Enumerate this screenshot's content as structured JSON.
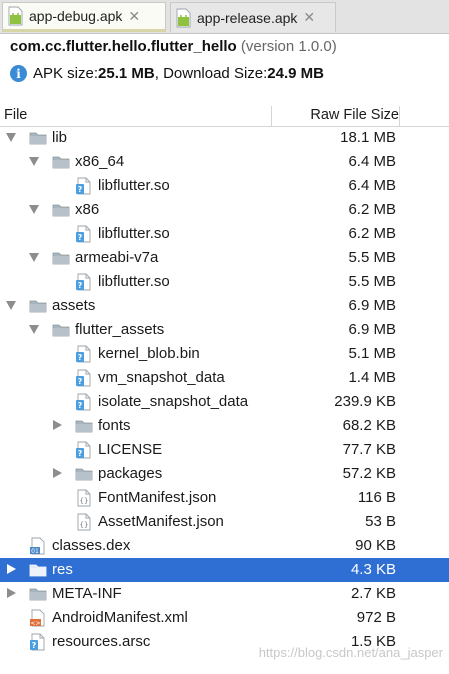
{
  "tabs": [
    {
      "label": "app-debug.apk",
      "active": true
    },
    {
      "label": "app-release.apk",
      "active": false
    }
  ],
  "header": {
    "package": "com.cc.flutter.hello.flutter_hello",
    "version": "(version 1.0.0)",
    "apk_size_label": "APK size: ",
    "apk_size": "25.1 MB",
    "download_label": ", Download Size: ",
    "download_size": "24.9 MB"
  },
  "table": {
    "col_file": "File",
    "col_size": "Raw File Size"
  },
  "rows": [
    {
      "name": "lib",
      "size": "18.1 MB"
    },
    {
      "name": "x86_64",
      "size": "6.4 MB"
    },
    {
      "name": "libflutter.so",
      "size": "6.4 MB"
    },
    {
      "name": "x86",
      "size": "6.2 MB"
    },
    {
      "name": "libflutter.so",
      "size": "6.2 MB"
    },
    {
      "name": "armeabi-v7a",
      "size": "5.5 MB"
    },
    {
      "name": "libflutter.so",
      "size": "5.5 MB"
    },
    {
      "name": "assets",
      "size": "6.9 MB"
    },
    {
      "name": "flutter_assets",
      "size": "6.9 MB"
    },
    {
      "name": "kernel_blob.bin",
      "size": "5.1 MB"
    },
    {
      "name": "vm_snapshot_data",
      "size": "1.4 MB"
    },
    {
      "name": "isolate_snapshot_data",
      "size": "239.9 KB"
    },
    {
      "name": "fonts",
      "size": "68.2 KB"
    },
    {
      "name": "LICENSE",
      "size": "77.7 KB"
    },
    {
      "name": "packages",
      "size": "57.2 KB"
    },
    {
      "name": "FontManifest.json",
      "size": "116 B"
    },
    {
      "name": "AssetManifest.json",
      "size": "53 B"
    },
    {
      "name": "classes.dex",
      "size": "90 KB"
    },
    {
      "name": "res",
      "size": "4.3 KB"
    },
    {
      "name": "META-INF",
      "size": "2.7 KB"
    },
    {
      "name": "AndroidManifest.xml",
      "size": "972 B"
    },
    {
      "name": "resources.arsc",
      "size": "1.5 KB"
    }
  ],
  "watermark": "https://blog.csdn.net/ana_jasper"
}
